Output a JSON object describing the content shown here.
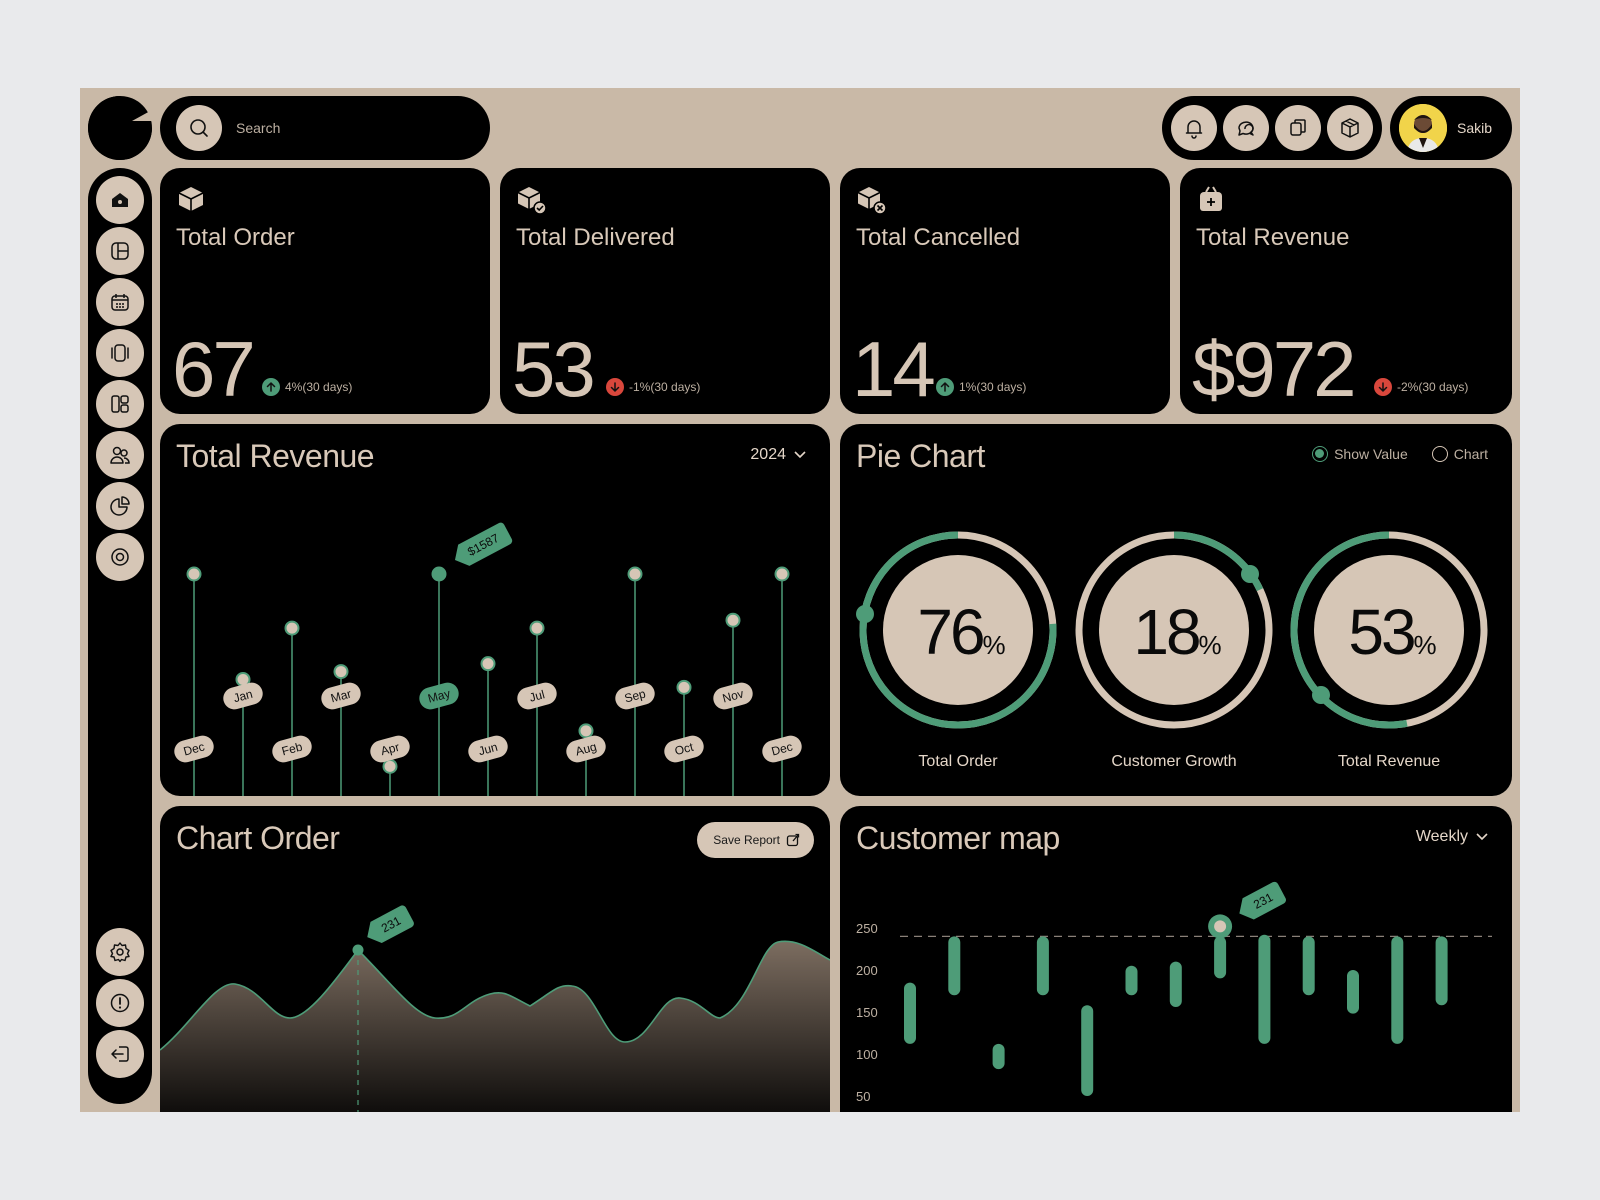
{
  "header": {
    "search_placeholder": "Search",
    "user_name": "Sakib",
    "icons": [
      "bell-icon",
      "chat-icon",
      "copy-icon",
      "box-icon"
    ]
  },
  "sidebar": {
    "items": [
      "home-icon",
      "layout-icon",
      "calendar-icon",
      "carousel-icon",
      "grid-icon",
      "users-icon",
      "pie-icon",
      "target-icon"
    ],
    "bottom": [
      "settings-icon",
      "info-icon",
      "logout-icon"
    ]
  },
  "stats": [
    {
      "title": "Total Order",
      "value": "67",
      "change": "4%(30 days)",
      "direction": "up"
    },
    {
      "title": "Total Delivered",
      "value": "53",
      "change": "-1%(30 days)",
      "direction": "down"
    },
    {
      "title": "Total Cancelled",
      "value": "14",
      "change": "1%(30 days)",
      "direction": "up"
    },
    {
      "title": "Total Revenue",
      "value": "$972",
      "change": "-2%(30 days)",
      "direction": "down"
    }
  ],
  "revenue": {
    "title": "Total Revenue",
    "year": "2024",
    "highlight_label": "$1587",
    "highlight_month": "May"
  },
  "pie": {
    "title": "Pie Chart",
    "legend_show_value": "Show Value",
    "legend_chart": "Chart",
    "items": [
      {
        "value": "76",
        "unit": "%",
        "label": "Total Order",
        "pct": 76
      },
      {
        "value": "18",
        "unit": "%",
        "label": "Customer Growth",
        "pct": 18
      },
      {
        "value": "53",
        "unit": "%",
        "label": "Total Revenue",
        "pct": 53
      }
    ]
  },
  "chart_order": {
    "title": "Chart Order",
    "save_label": "Save Report",
    "peak_label": "231"
  },
  "customer_map": {
    "title": "Customer map",
    "period": "Weekly",
    "peak_label": "231"
  },
  "colors": {
    "accent": "#4e9c78",
    "beige": "#d6c6b6",
    "down": "#d9473c"
  },
  "chart_data": [
    {
      "type": "lollipop",
      "categories": [
        "Dec",
        "Jan",
        "Feb",
        "Mar",
        "Apr",
        "May",
        "Jun",
        "Jul",
        "Aug",
        "Sep",
        "Oct",
        "Nov",
        "Dec"
      ],
      "values": [
        1587,
        1320,
        1450,
        1340,
        1100,
        1587,
        1360,
        1450,
        1190,
        1587,
        1300,
        1470,
        1587
      ],
      "highlight": "May"
    },
    {
      "type": "area",
      "peak": 231
    },
    {
      "type": "bar",
      "series": [
        {
          "values": [
            [
              112,
              185
            ],
            [
              170,
              240
            ],
            [
              82,
              112
            ],
            [
              170,
              240
            ],
            [
              50,
              158
            ],
            [
              170,
              205
            ],
            [
              156,
              210
            ],
            [
              190,
              240
            ],
            [
              112,
              242
            ],
            [
              170,
              240
            ],
            [
              148,
              200
            ],
            [
              112,
              240
            ],
            [
              158,
              240
            ]
          ]
        }
      ],
      "yticks": [
        50,
        100,
        150,
        200,
        250
      ],
      "ylim": [
        50,
        250
      ],
      "reference": 240,
      "peak_label": 231
    }
  ]
}
